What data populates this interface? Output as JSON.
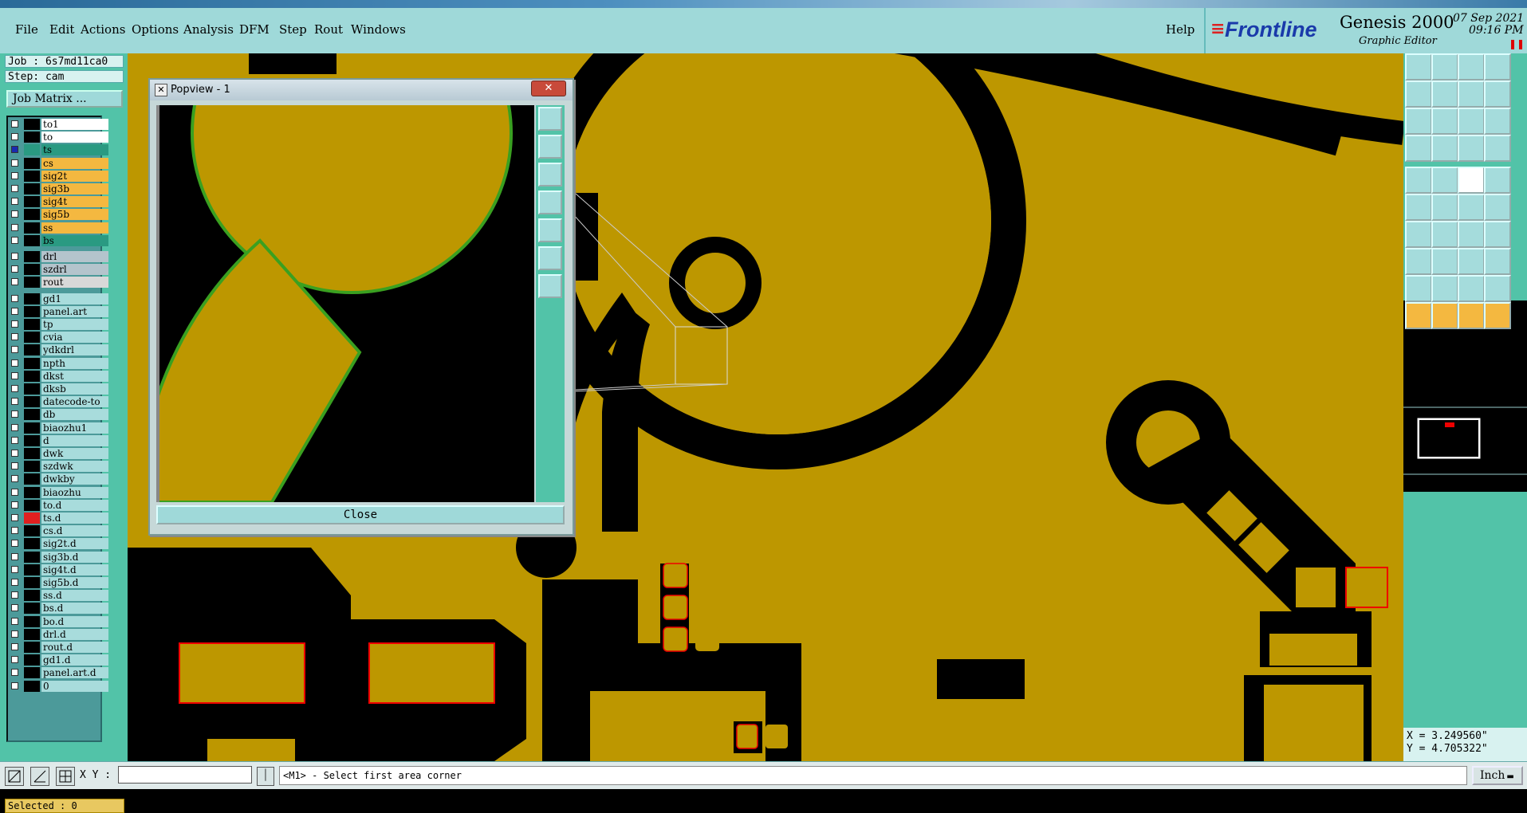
{
  "menu": [
    "File",
    "Edit",
    "Actions",
    "Options",
    "Analysis",
    "DFM",
    "Step",
    "Rout",
    "Windows"
  ],
  "help_label": "Help",
  "brand": {
    "logo": "Frontline",
    "product": "Genesis 2000",
    "subtitle": "Graphic Editor",
    "date": "07 Sep 2021",
    "time": "09:16 PM"
  },
  "job": {
    "job_label": "Job : 6s7md11ca0",
    "step_label": "Step: cam",
    "matrix_button": "Job Matrix ..."
  },
  "layers": [
    {
      "name": "to1",
      "bg": "#ffffff",
      "swatch": "#000000",
      "active": false
    },
    {
      "name": "to",
      "bg": "#ffffff",
      "swatch": "#000000",
      "active": false
    },
    {
      "name": "ts",
      "bg": "#2a9a82",
      "swatch": "#2a9a82",
      "active": true
    },
    {
      "name": "cs",
      "bg": "#f4b840",
      "swatch": "#000000",
      "active": false
    },
    {
      "name": "sig2t",
      "bg": "#f4b840",
      "swatch": "#000000",
      "active": false
    },
    {
      "name": "sig3b",
      "bg": "#f4b840",
      "swatch": "#000000",
      "active": false
    },
    {
      "name": "sig4t",
      "bg": "#f4b840",
      "swatch": "#000000",
      "active": false
    },
    {
      "name": "sig5b",
      "bg": "#f4b840",
      "swatch": "#000000",
      "active": false
    },
    {
      "name": "ss",
      "bg": "#f4b840",
      "swatch": "#000000",
      "active": false
    },
    {
      "name": "bs",
      "bg": "#2a9a82",
      "swatch": "#000000",
      "active": false
    },
    {
      "name": "drl",
      "bg": "#b4c4cc",
      "swatch": "#000000",
      "active": false
    },
    {
      "name": "szdrl",
      "bg": "#b4c4cc",
      "swatch": "#000000",
      "active": false
    },
    {
      "name": "rout",
      "bg": "#d8d8d8",
      "swatch": "#000000",
      "active": false
    },
    {
      "name": "gd1",
      "bg": "#a8dcdc",
      "swatch": "#000000",
      "active": false
    },
    {
      "name": "panel.art",
      "bg": "#a8dcdc",
      "swatch": "#000000",
      "active": false
    },
    {
      "name": "tp",
      "bg": "#a8dcdc",
      "swatch": "#000000",
      "active": false
    },
    {
      "name": "cvia",
      "bg": "#a8dcdc",
      "swatch": "#000000",
      "active": false
    },
    {
      "name": "ydkdrl",
      "bg": "#a8dcdc",
      "swatch": "#000000",
      "active": false
    },
    {
      "name": "npth",
      "bg": "#a8dcdc",
      "swatch": "#000000",
      "active": false
    },
    {
      "name": "dkst",
      "bg": "#a8dcdc",
      "swatch": "#000000",
      "active": false
    },
    {
      "name": "dksb",
      "bg": "#a8dcdc",
      "swatch": "#000000",
      "active": false
    },
    {
      "name": "datecode-to",
      "bg": "#a8dcdc",
      "swatch": "#000000",
      "active": false
    },
    {
      "name": "db",
      "bg": "#a8dcdc",
      "swatch": "#000000",
      "active": false
    },
    {
      "name": "biaozhu1",
      "bg": "#a8dcdc",
      "swatch": "#000000",
      "active": false
    },
    {
      "name": "d",
      "bg": "#a8dcdc",
      "swatch": "#000000",
      "active": false
    },
    {
      "name": "dwk",
      "bg": "#a8dcdc",
      "swatch": "#000000",
      "active": false
    },
    {
      "name": "szdwk",
      "bg": "#a8dcdc",
      "swatch": "#000000",
      "active": false
    },
    {
      "name": "dwkby",
      "bg": "#a8dcdc",
      "swatch": "#000000",
      "active": false
    },
    {
      "name": "biaozhu",
      "bg": "#a8dcdc",
      "swatch": "#000000",
      "active": false
    },
    {
      "name": "to.d",
      "bg": "#a8dcdc",
      "swatch": "#000000",
      "active": false
    },
    {
      "name": "ts.d",
      "bg": "#a8dcdc",
      "swatch": "#e02020",
      "active": false
    },
    {
      "name": "cs.d",
      "bg": "#a8dcdc",
      "swatch": "#000000",
      "active": false
    },
    {
      "name": "sig2t.d",
      "bg": "#a8dcdc",
      "swatch": "#000000",
      "active": false
    },
    {
      "name": "sig3b.d",
      "bg": "#a8dcdc",
      "swatch": "#000000",
      "active": false
    },
    {
      "name": "sig4t.d",
      "bg": "#a8dcdc",
      "swatch": "#000000",
      "active": false
    },
    {
      "name": "sig5b.d",
      "bg": "#a8dcdc",
      "swatch": "#000000",
      "active": false
    },
    {
      "name": "ss.d",
      "bg": "#a8dcdc",
      "swatch": "#000000",
      "active": false
    },
    {
      "name": "bs.d",
      "bg": "#a8dcdc",
      "swatch": "#000000",
      "active": false
    },
    {
      "name": "bo.d",
      "bg": "#a8dcdc",
      "swatch": "#000000",
      "active": false
    },
    {
      "name": "drl.d",
      "bg": "#a8dcdc",
      "swatch": "#000000",
      "active": false
    },
    {
      "name": "rout.d",
      "bg": "#a8dcdc",
      "swatch": "#000000",
      "active": false
    },
    {
      "name": "gd1.d",
      "bg": "#a8dcdc",
      "swatch": "#000000",
      "active": false
    },
    {
      "name": "panel.art.d",
      "bg": "#a8dcdc",
      "swatch": "#000000",
      "active": false
    },
    {
      "name": "0",
      "bg": "#a8dcdc",
      "swatch": "#000000",
      "active": false
    }
  ],
  "selected_label": "Selected : 0",
  "popview": {
    "title": "Popview - 1",
    "close_label": "Close"
  },
  "coords": {
    "x": "X = 3.249560\"",
    "y": "Y = 4.705322\""
  },
  "bottom": {
    "xy_label": "X Y :",
    "xy_value": "",
    "prompt": "<M1> - Select first area corner",
    "units": "Inch"
  },
  "colors": {
    "copper": "#bd9700",
    "void": "#000000",
    "panel": "#52c3a8",
    "menubar": "#9fd9d9"
  }
}
